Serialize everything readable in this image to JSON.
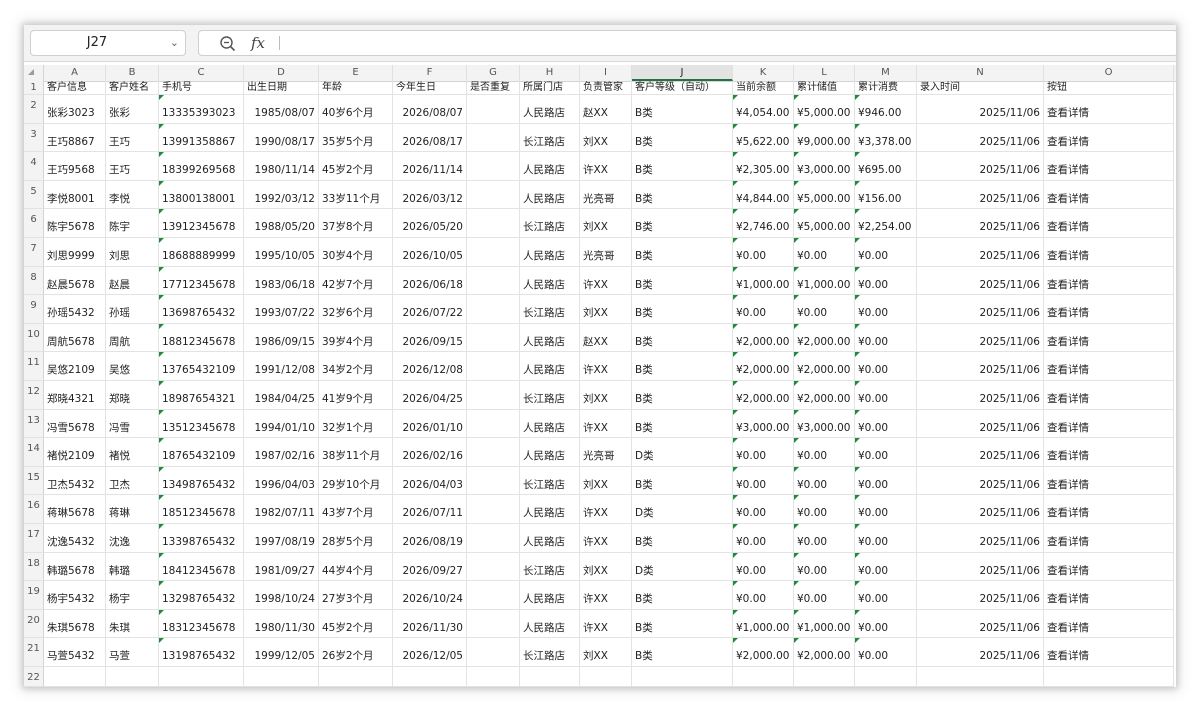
{
  "formula_bar": {
    "cell_ref": "J27",
    "fx_label": "fx",
    "formula": ""
  },
  "columns": [
    "A",
    "B",
    "C",
    "D",
    "E",
    "F",
    "G",
    "H",
    "I",
    "J",
    "K",
    "L",
    "M",
    "N",
    "O"
  ],
  "selected_column": "J",
  "headers": [
    "客户信息",
    "客户姓名",
    "手机号",
    "出生日期",
    "年龄",
    "今年生日",
    "是否重复",
    "所属门店",
    "负责管家",
    "客户等级（自动）",
    "当前余额",
    "累计储值",
    "累计消费",
    "录入时间",
    "按钮"
  ],
  "rows": [
    [
      "张彩3023",
      "张彩",
      "13335393023",
      "1985/08/07",
      "40岁6个月",
      "2026/08/07",
      "",
      "人民路店",
      "赵XX",
      "B类",
      "¥4,054.00",
      "¥5,000.00",
      "¥946.00",
      "2025/11/06",
      "查看详情"
    ],
    [
      "王巧8867",
      "王巧",
      "13991358867",
      "1990/08/17",
      "35岁5个月",
      "2026/08/17",
      "",
      "长江路店",
      "刘XX",
      "B类",
      "¥5,622.00",
      "¥9,000.00",
      "¥3,378.00",
      "2025/11/06",
      "查看详情"
    ],
    [
      "王巧9568",
      "王巧",
      "18399269568",
      "1980/11/14",
      "45岁2个月",
      "2026/11/14",
      "",
      "人民路店",
      "许XX",
      "B类",
      "¥2,305.00",
      "¥3,000.00",
      "¥695.00",
      "2025/11/06",
      "查看详情"
    ],
    [
      "李悦8001",
      "李悦",
      "13800138001",
      "1992/03/12",
      "33岁11个月",
      "2026/03/12",
      "",
      "人民路店",
      "光亮哥",
      "B类",
      "¥4,844.00",
      "¥5,000.00",
      "¥156.00",
      "2025/11/06",
      "查看详情"
    ],
    [
      "陈宇5678",
      "陈宇",
      "13912345678",
      "1988/05/20",
      "37岁8个月",
      "2026/05/20",
      "",
      "长江路店",
      "刘XX",
      "B类",
      "¥2,746.00",
      "¥5,000.00",
      "¥2,254.00",
      "2025/11/06",
      "查看详情"
    ],
    [
      "刘思9999",
      "刘思",
      "18688889999",
      "1995/10/05",
      "30岁4个月",
      "2026/10/05",
      "",
      "人民路店",
      "光亮哥",
      "B类",
      "¥0.00",
      "¥0.00",
      "¥0.00",
      "2025/11/06",
      "查看详情"
    ],
    [
      "赵晨5678",
      "赵晨",
      "17712345678",
      "1983/06/18",
      "42岁7个月",
      "2026/06/18",
      "",
      "人民路店",
      "许XX",
      "B类",
      "¥1,000.00",
      "¥1,000.00",
      "¥0.00",
      "2025/11/06",
      "查看详情"
    ],
    [
      "孙瑶5432",
      "孙瑶",
      "13698765432",
      "1993/07/22",
      "32岁6个月",
      "2026/07/22",
      "",
      "长江路店",
      "刘XX",
      "B类",
      "¥0.00",
      "¥0.00",
      "¥0.00",
      "2025/11/06",
      "查看详情"
    ],
    [
      "周航5678",
      "周航",
      "18812345678",
      "1986/09/15",
      "39岁4个月",
      "2026/09/15",
      "",
      "人民路店",
      "赵XX",
      "B类",
      "¥2,000.00",
      "¥2,000.00",
      "¥0.00",
      "2025/11/06",
      "查看详情"
    ],
    [
      "吴悠2109",
      "吴悠",
      "13765432109",
      "1991/12/08",
      "34岁2个月",
      "2026/12/08",
      "",
      "人民路店",
      "许XX",
      "B类",
      "¥2,000.00",
      "¥2,000.00",
      "¥0.00",
      "2025/11/06",
      "查看详情"
    ],
    [
      "郑晓4321",
      "郑晓",
      "18987654321",
      "1984/04/25",
      "41岁9个月",
      "2026/04/25",
      "",
      "长江路店",
      "刘XX",
      "B类",
      "¥2,000.00",
      "¥2,000.00",
      "¥0.00",
      "2025/11/06",
      "查看详情"
    ],
    [
      "冯雪5678",
      "冯雪",
      "13512345678",
      "1994/01/10",
      "32岁1个月",
      "2026/01/10",
      "",
      "人民路店",
      "许XX",
      "B类",
      "¥3,000.00",
      "¥3,000.00",
      "¥0.00",
      "2025/11/06",
      "查看详情"
    ],
    [
      "褚悦2109",
      "褚悦",
      "18765432109",
      "1987/02/16",
      "38岁11个月",
      "2026/02/16",
      "",
      "人民路店",
      "光亮哥",
      "D类",
      "¥0.00",
      "¥0.00",
      "¥0.00",
      "2025/11/06",
      "查看详情"
    ],
    [
      "卫杰5432",
      "卫杰",
      "13498765432",
      "1996/04/03",
      "29岁10个月",
      "2026/04/03",
      "",
      "长江路店",
      "刘XX",
      "B类",
      "¥0.00",
      "¥0.00",
      "¥0.00",
      "2025/11/06",
      "查看详情"
    ],
    [
      "蒋琳5678",
      "蒋琳",
      "18512345678",
      "1982/07/11",
      "43岁7个月",
      "2026/07/11",
      "",
      "人民路店",
      "许XX",
      "D类",
      "¥0.00",
      "¥0.00",
      "¥0.00",
      "2025/11/06",
      "查看详情"
    ],
    [
      "沈逸5432",
      "沈逸",
      "13398765432",
      "1997/08/19",
      "28岁5个月",
      "2026/08/19",
      "",
      "人民路店",
      "许XX",
      "B类",
      "¥0.00",
      "¥0.00",
      "¥0.00",
      "2025/11/06",
      "查看详情"
    ],
    [
      "韩璐5678",
      "韩璐",
      "18412345678",
      "1981/09/27",
      "44岁4个月",
      "2026/09/27",
      "",
      "长江路店",
      "刘XX",
      "D类",
      "¥0.00",
      "¥0.00",
      "¥0.00",
      "2025/11/06",
      "查看详情"
    ],
    [
      "杨宇5432",
      "杨宇",
      "13298765432",
      "1998/10/24",
      "27岁3个月",
      "2026/10/24",
      "",
      "人民路店",
      "许XX",
      "B类",
      "¥0.00",
      "¥0.00",
      "¥0.00",
      "2025/11/06",
      "查看详情"
    ],
    [
      "朱琪5678",
      "朱琪",
      "18312345678",
      "1980/11/30",
      "45岁2个月",
      "2026/11/30",
      "",
      "人民路店",
      "许XX",
      "B类",
      "¥1,000.00",
      "¥1,000.00",
      "¥0.00",
      "2025/11/06",
      "查看详情"
    ],
    [
      "马萱5432",
      "马萱",
      "13198765432",
      "1999/12/05",
      "26岁2个月",
      "2026/12/05",
      "",
      "长江路店",
      "刘XX",
      "B类",
      "¥2,000.00",
      "¥2,000.00",
      "¥0.00",
      "2025/11/06",
      "查看详情"
    ]
  ],
  "colors": {
    "accent": "#217346",
    "comment_marker": "#1e8c3a",
    "grid_line": "#e3e3e3",
    "header_bg": "#f3f3f3"
  }
}
